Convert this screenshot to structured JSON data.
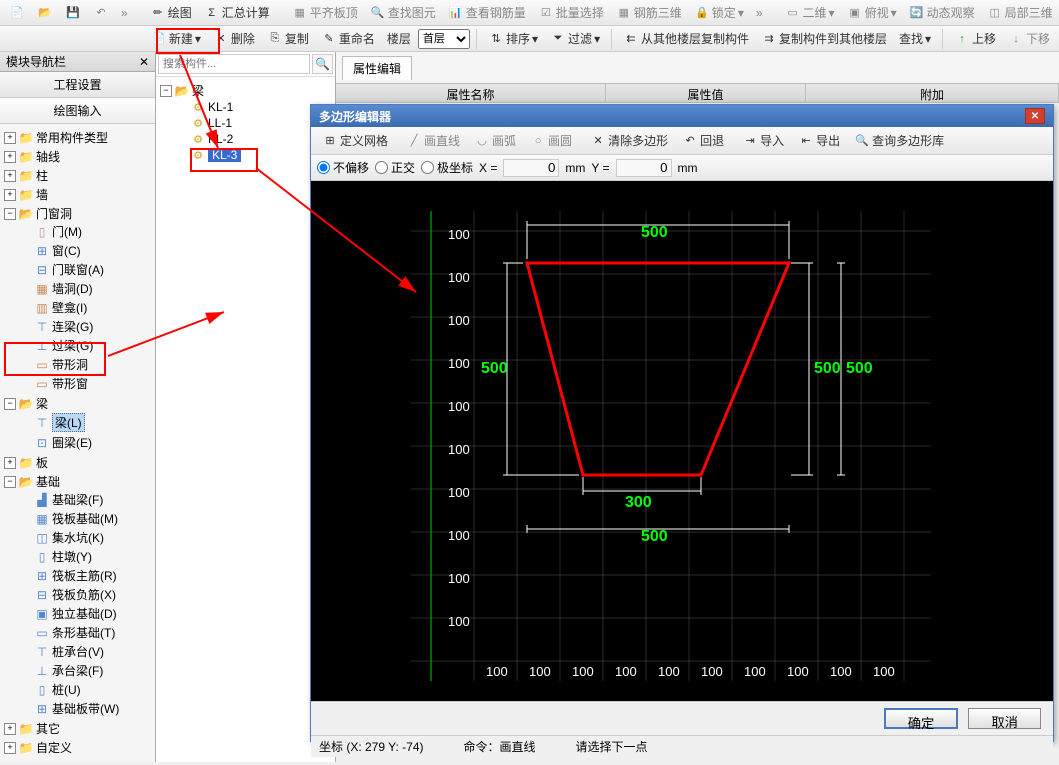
{
  "top_toolbar1": {
    "draw": "绘图",
    "summary": "汇总计算",
    "flat_roof": "平齐板顶",
    "find_elem": "查找图元",
    "view_rebar": "查看钢筋量",
    "batch_sel": "批量选择",
    "rebar_3d": "钢筋三维",
    "lock": "锁定",
    "two_d": "二维",
    "perspective": "俯视",
    "dynamic_view": "动态观察",
    "local_3d": "局部三维"
  },
  "top_toolbar2": {
    "new": "新建",
    "delete": "删除",
    "copy": "复制",
    "rename": "重命名",
    "floor": "楼层",
    "first_floor": "首层",
    "sort": "排序",
    "filter": "过滤",
    "copy_from_other": "从其他楼层复制构件",
    "copy_to_other": "复制构件到其他楼层",
    "find": "查找",
    "move_up": "上移",
    "move_down": "下移"
  },
  "nav": {
    "title": "模块导航栏",
    "tab1": "工程设置",
    "tab2": "绘图输入",
    "items": {
      "common": "常用构件类型",
      "axis": "轴线",
      "column": "柱",
      "wall": "墙",
      "opening": "门窗洞",
      "door": "门(M)",
      "window": "窗(C)",
      "door_window": "门联窗(A)",
      "wall_hole": "墙洞(D)",
      "wall_niche": "壁龛(I)",
      "lintel_beam": "连梁(G)",
      "over_beam": "过梁(G)",
      "band_hole": "带形洞",
      "band_win": "带形窗",
      "beam": "梁",
      "beam_l": "梁(L)",
      "ring_beam": "圈梁(E)",
      "slab": "板",
      "foundation": "基础",
      "fnd_beam": "基础梁(F)",
      "raft_fnd": "筏板基础(M)",
      "sump": "集水坑(K)",
      "pier": "柱墩(Y)",
      "raft_main": "筏板主筋(R)",
      "raft_neg": "筏板负筋(X)",
      "iso_fnd": "独立基础(D)",
      "strip_fnd": "条形基础(T)",
      "pile_cap": "桩承台(V)",
      "cap_beam": "承台梁(F)",
      "pile": "桩(U)",
      "fnd_strip": "基础板带(W)",
      "other": "其它",
      "custom": "自定义"
    }
  },
  "mid": {
    "search_placeholder": "搜索构件...",
    "beam": "梁",
    "kl1": "KL-1",
    "ll1": "LL-1",
    "kl2": "KL-2",
    "kl3": "KL-3"
  },
  "prop": {
    "tab": "属性编辑",
    "col_name": "属性名称",
    "col_value": "属性值",
    "col_extra": "附加"
  },
  "dialog": {
    "title": "多边形编辑器",
    "define_grid": "定义网格",
    "line": "画直线",
    "arc": "画弧",
    "circle": "画圆",
    "clear_poly": "清除多边形",
    "undo": "回退",
    "import": "导入",
    "export": "导出",
    "query_lib": "查询多边形库",
    "no_offset": "不偏移",
    "ortho": "正交",
    "polar": "极坐标",
    "x_label": "X =",
    "y_label": "Y =",
    "x_val": "0",
    "y_val": "0",
    "unit": "mm",
    "ok": "确定",
    "cancel": "取消",
    "coord": "坐标 (X: 279 Y: -74)",
    "cmd": "命令：画直线",
    "hint": "请选择下一点"
  },
  "chart_data": {
    "type": "polygon",
    "grid_spacing": 100,
    "top_width": 500,
    "bottom_width": 300,
    "left_height": 500,
    "right_height": 500,
    "right_height2": 500,
    "bottom_span": 500,
    "y_ticks": [
      100,
      100,
      100,
      100,
      100,
      100,
      100,
      100,
      100,
      100
    ],
    "x_ticks": [
      100,
      100,
      100,
      100,
      100,
      100,
      100,
      100,
      100,
      100
    ]
  }
}
